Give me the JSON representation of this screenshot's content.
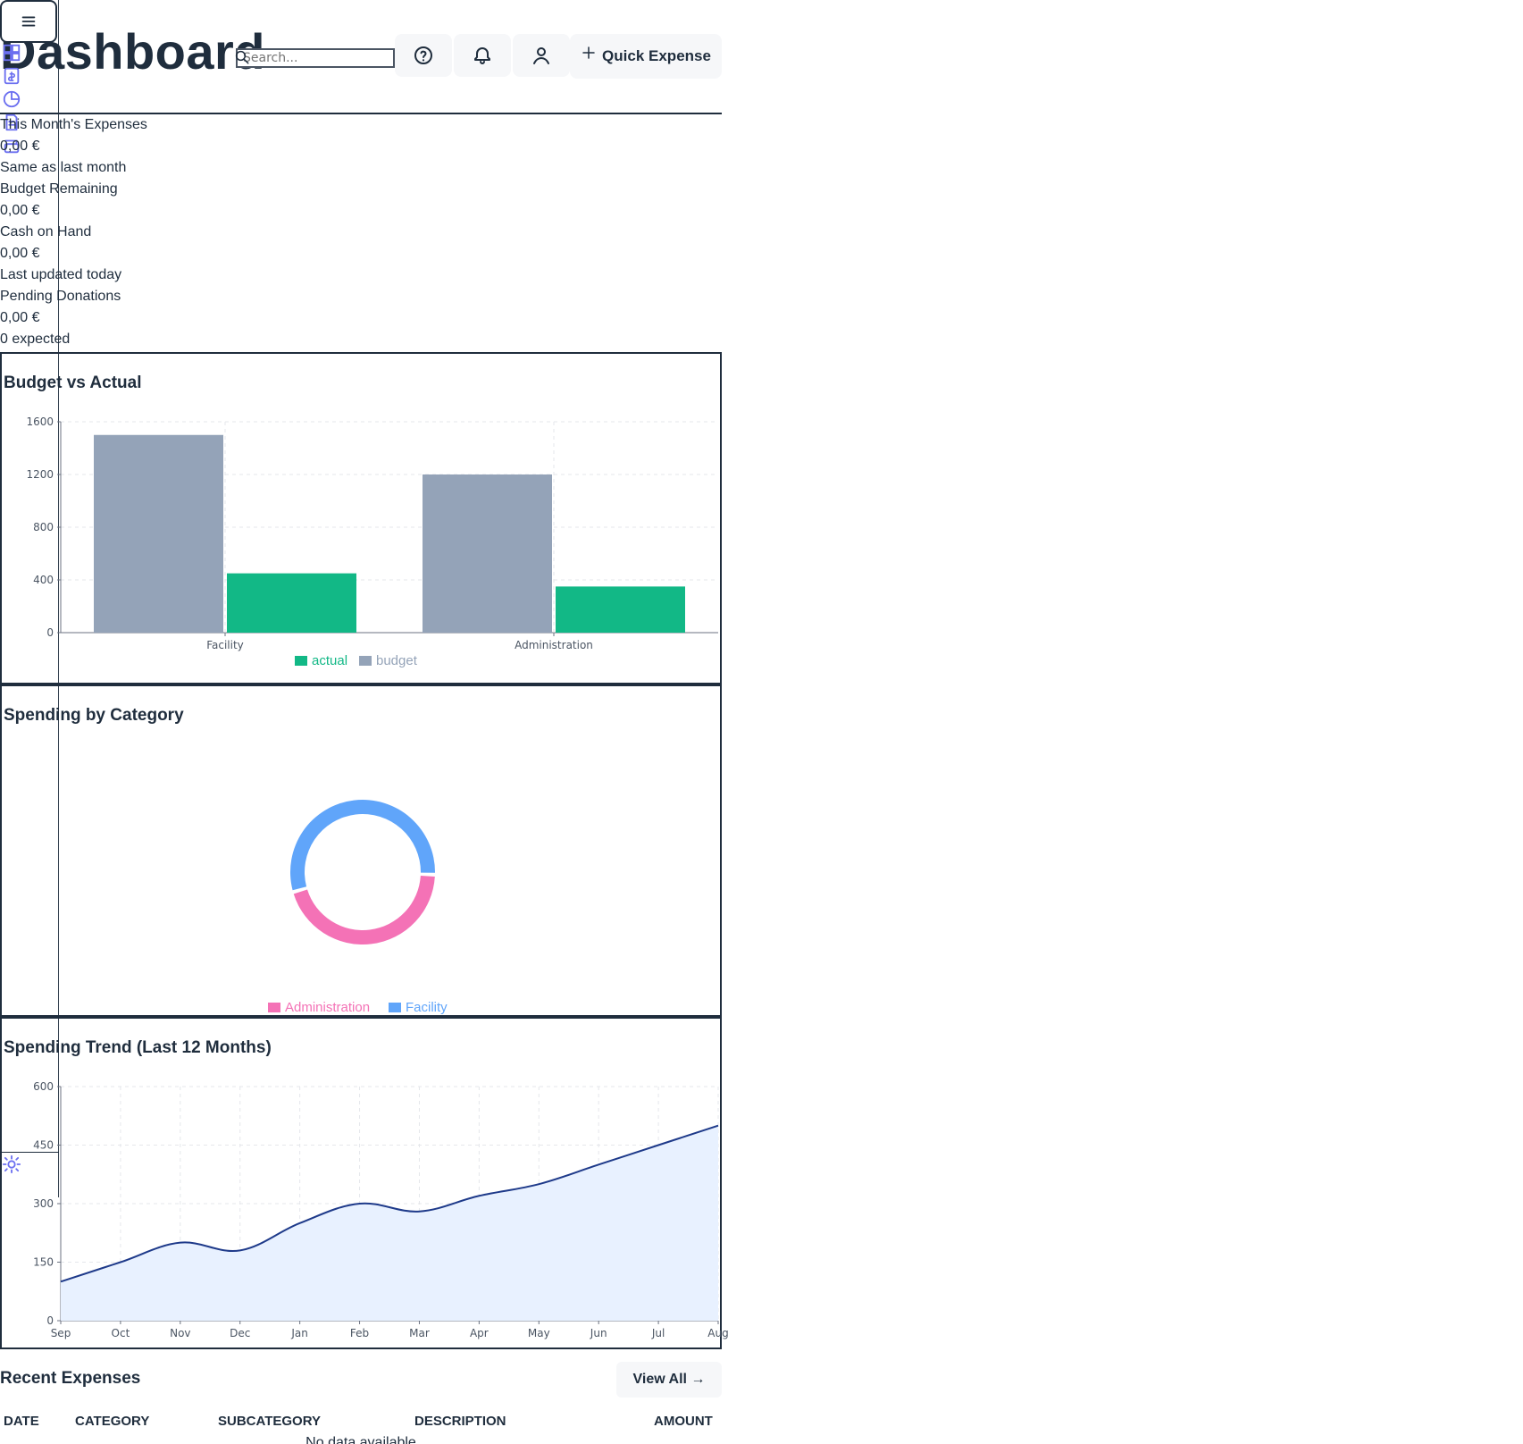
{
  "header": {
    "title": "Dashboard",
    "search_placeholder": "Search...",
    "quick_expense_label": "Quick Expense"
  },
  "kpis": {
    "this_month_label": "This Month's Expenses",
    "this_month_value": "0,00 €",
    "this_month_delta": "Same as last month",
    "budget_remaining_label": "Budget Remaining",
    "budget_remaining_value": "0,00 €",
    "cash_on_hand_label": "Cash on Hand",
    "cash_on_hand_value": "0,00 €",
    "cash_on_hand_note": "Last updated today",
    "pending_donations_label": "Pending Donations",
    "pending_donations_value": "0,00 €",
    "pending_donations_note": "0 expected"
  },
  "panels": {
    "budget_vs_actual_title": "Budget vs Actual",
    "spending_by_category_title": "Spending by Category",
    "spending_trend_title": "Spending Trend (Last 12 Months)"
  },
  "recent_expenses": {
    "title": "Recent Expenses",
    "view_all_label": "View All →",
    "columns": [
      "DATE",
      "CATEGORY",
      "SUBCATEGORY",
      "DESCRIPTION",
      "AMOUNT"
    ],
    "empty_text": "No data available"
  },
  "icons": {
    "menu": "hamburger-menu-icon",
    "help": "help-circle-icon",
    "notifications": "bell-icon",
    "account": "user-icon",
    "add": "plus-icon",
    "search": "search-icon",
    "settings": "gear-icon"
  },
  "colors": {
    "text": "#1f2d3d",
    "accent_rail": "#6b6ff0",
    "actual": "#12b886",
    "budget": "#94a3b8",
    "administration": "#f472b6",
    "facility": "#60a5fa",
    "trend_line": "#1e3a8a",
    "trend_fill": "#e8f1ff"
  },
  "chart_data": [
    {
      "type": "bar",
      "title": "Budget vs Actual",
      "categories": [
        "Facility",
        "Administration"
      ],
      "series": [
        {
          "name": "budget",
          "values": [
            1500,
            1200
          ]
        },
        {
          "name": "actual",
          "values": [
            450,
            350
          ]
        }
      ],
      "ylim": [
        0,
        1600
      ],
      "yticks": [
        0,
        400,
        800,
        1200,
        1600
      ],
      "legend": [
        "actual",
        "budget"
      ],
      "legend_position": "bottom-center",
      "grid": true
    },
    {
      "type": "pie",
      "title": "Spending by Category",
      "categories": [
        "Administration",
        "Facility"
      ],
      "values": [
        45,
        55
      ],
      "legend": [
        "Administration",
        "Facility"
      ],
      "legend_position": "bottom-center"
    },
    {
      "type": "area",
      "title": "Spending Trend (Last 12 Months)",
      "categories": [
        "Sep",
        "Oct",
        "Nov",
        "Dec",
        "Jan",
        "Feb",
        "Mar",
        "Apr",
        "May",
        "Jun",
        "Jul",
        "Aug"
      ],
      "values": [
        100,
        150,
        200,
        180,
        250,
        300,
        280,
        320,
        350,
        400,
        450,
        500
      ],
      "ylim": [
        0,
        600
      ],
      "yticks": [
        0,
        150,
        300,
        450,
        600
      ],
      "grid": true
    }
  ]
}
